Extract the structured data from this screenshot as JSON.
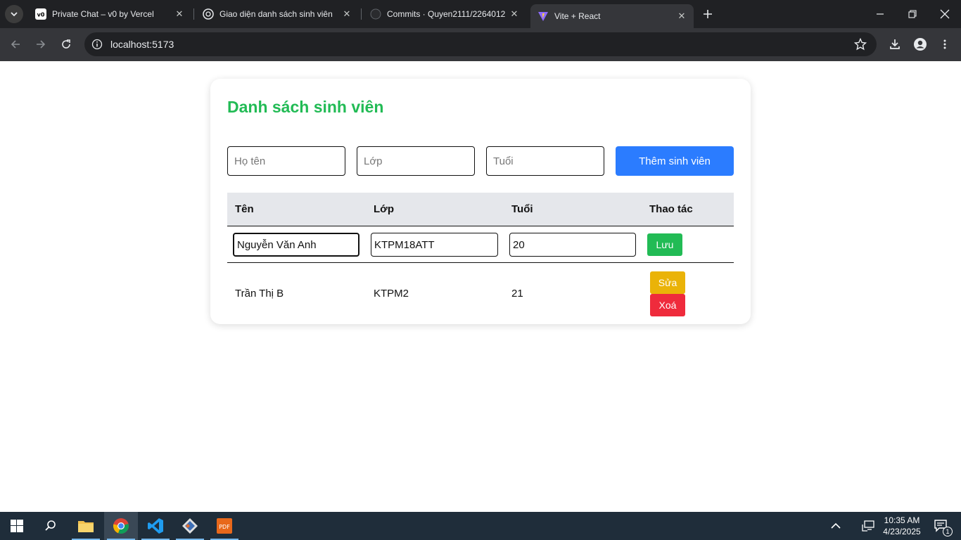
{
  "browser": {
    "tabs": [
      {
        "title": "Private Chat – v0 by Vercel",
        "icon": "v0-icon"
      },
      {
        "title": "Giao diện danh sách sinh viên",
        "icon": "chatgpt-icon"
      },
      {
        "title": "Commits · Quyen2111/2264012",
        "icon": "github-icon"
      },
      {
        "title": "Vite + React",
        "icon": "vite-icon",
        "active": true
      }
    ],
    "url": "localhost:5173"
  },
  "app": {
    "title": "Danh sách sinh viên",
    "form": {
      "name_placeholder": "Họ tên",
      "class_placeholder": "Lớp",
      "age_placeholder": "Tuổi",
      "add_button": "Thêm sinh viên"
    },
    "table": {
      "headers": [
        "Tên",
        "Lớp",
        "Tuổi",
        "Thao tác"
      ],
      "editing_row": {
        "name": "Nguyễn Văn Anh",
        "class": "KTPM18ATT",
        "age": "20",
        "save_label": "Lưu"
      },
      "rows": [
        {
          "name": "Trần Thị B",
          "class": "KTPM2",
          "age": "21",
          "edit_label": "Sửa",
          "delete_label": "Xoá"
        }
      ]
    }
  },
  "taskbar": {
    "time": "10:35 AM",
    "date": "4/23/2025",
    "notification_count": "1"
  },
  "colors": {
    "title_green": "#22bb55",
    "add_blue": "#2b7cff",
    "save_green": "#22bb55",
    "edit_yellow": "#eab308",
    "delete_red": "#ef2b3c"
  }
}
